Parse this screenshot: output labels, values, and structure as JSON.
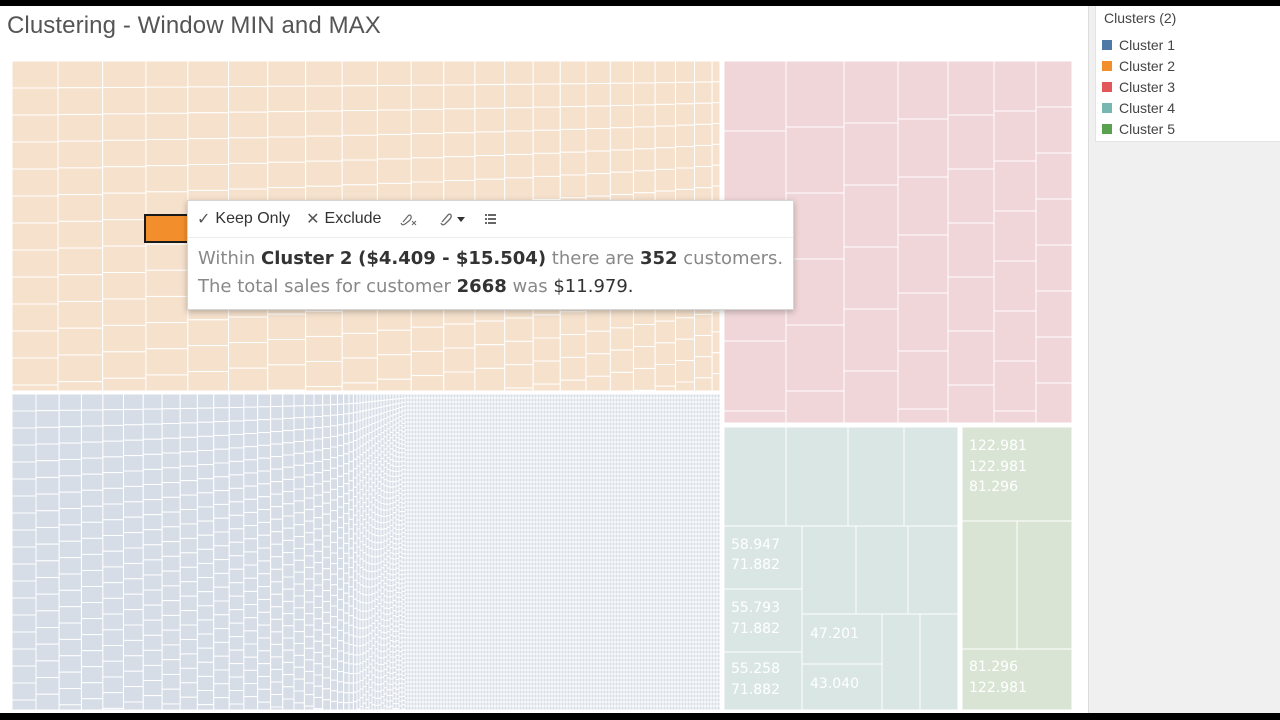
{
  "title": "Clustering - Window MIN and MAX",
  "legend": {
    "title": "Clusters (2)",
    "items": [
      {
        "label": "Cluster 1",
        "color": "#4e79a7"
      },
      {
        "label": "Cluster 2",
        "color": "#f28e2b"
      },
      {
        "label": "Cluster 3",
        "color": "#e15759"
      },
      {
        "label": "Cluster 4",
        "color": "#76b7b2"
      },
      {
        "label": "Cluster 5",
        "color": "#59a14f"
      }
    ]
  },
  "tooltip": {
    "toolbar": {
      "keep_only": "Keep Only",
      "exclude": "Exclude"
    },
    "line1": {
      "prefix": "Within",
      "cluster": "Cluster 2",
      "range": "($4.409 - $15.504)",
      "middle": "there are",
      "count": "352",
      "suffix": "customers."
    },
    "line2": {
      "prefix": "The total sales for customer",
      "customer": "2668",
      "middle": "was",
      "amount": "$11.979",
      "suffix": "."
    }
  },
  "chart_data": {
    "type": "treemap",
    "marks": [
      {
        "cluster": "Cluster 2",
        "color": "#f28e2b",
        "fill": "#f5e1cc",
        "labels": []
      },
      {
        "cluster": "Cluster 3",
        "color": "#e15759",
        "fill": "#f0d6d8",
        "labels": []
      },
      {
        "cluster": "Cluster 1",
        "color": "#4e79a7",
        "fill": "#d6dde6",
        "labels": []
      },
      {
        "cluster": "Cluster 4",
        "color": "#76b7b2",
        "fill": "#dae6e4",
        "labels": [
          "58.947",
          "71.882",
          "55.793",
          "71.882",
          "55.258",
          "71.882",
          "47.201",
          "43.040"
        ]
      },
      {
        "cluster": "Cluster 5",
        "color": "#59a14f",
        "fill": "#d9e4d4",
        "labels": [
          "122.981",
          "122.981",
          "81.296",
          "81.296",
          "122.981"
        ]
      }
    ],
    "highlighted": {
      "cluster": "Cluster 2",
      "customer": "2668",
      "sales": "$11.979"
    }
  }
}
